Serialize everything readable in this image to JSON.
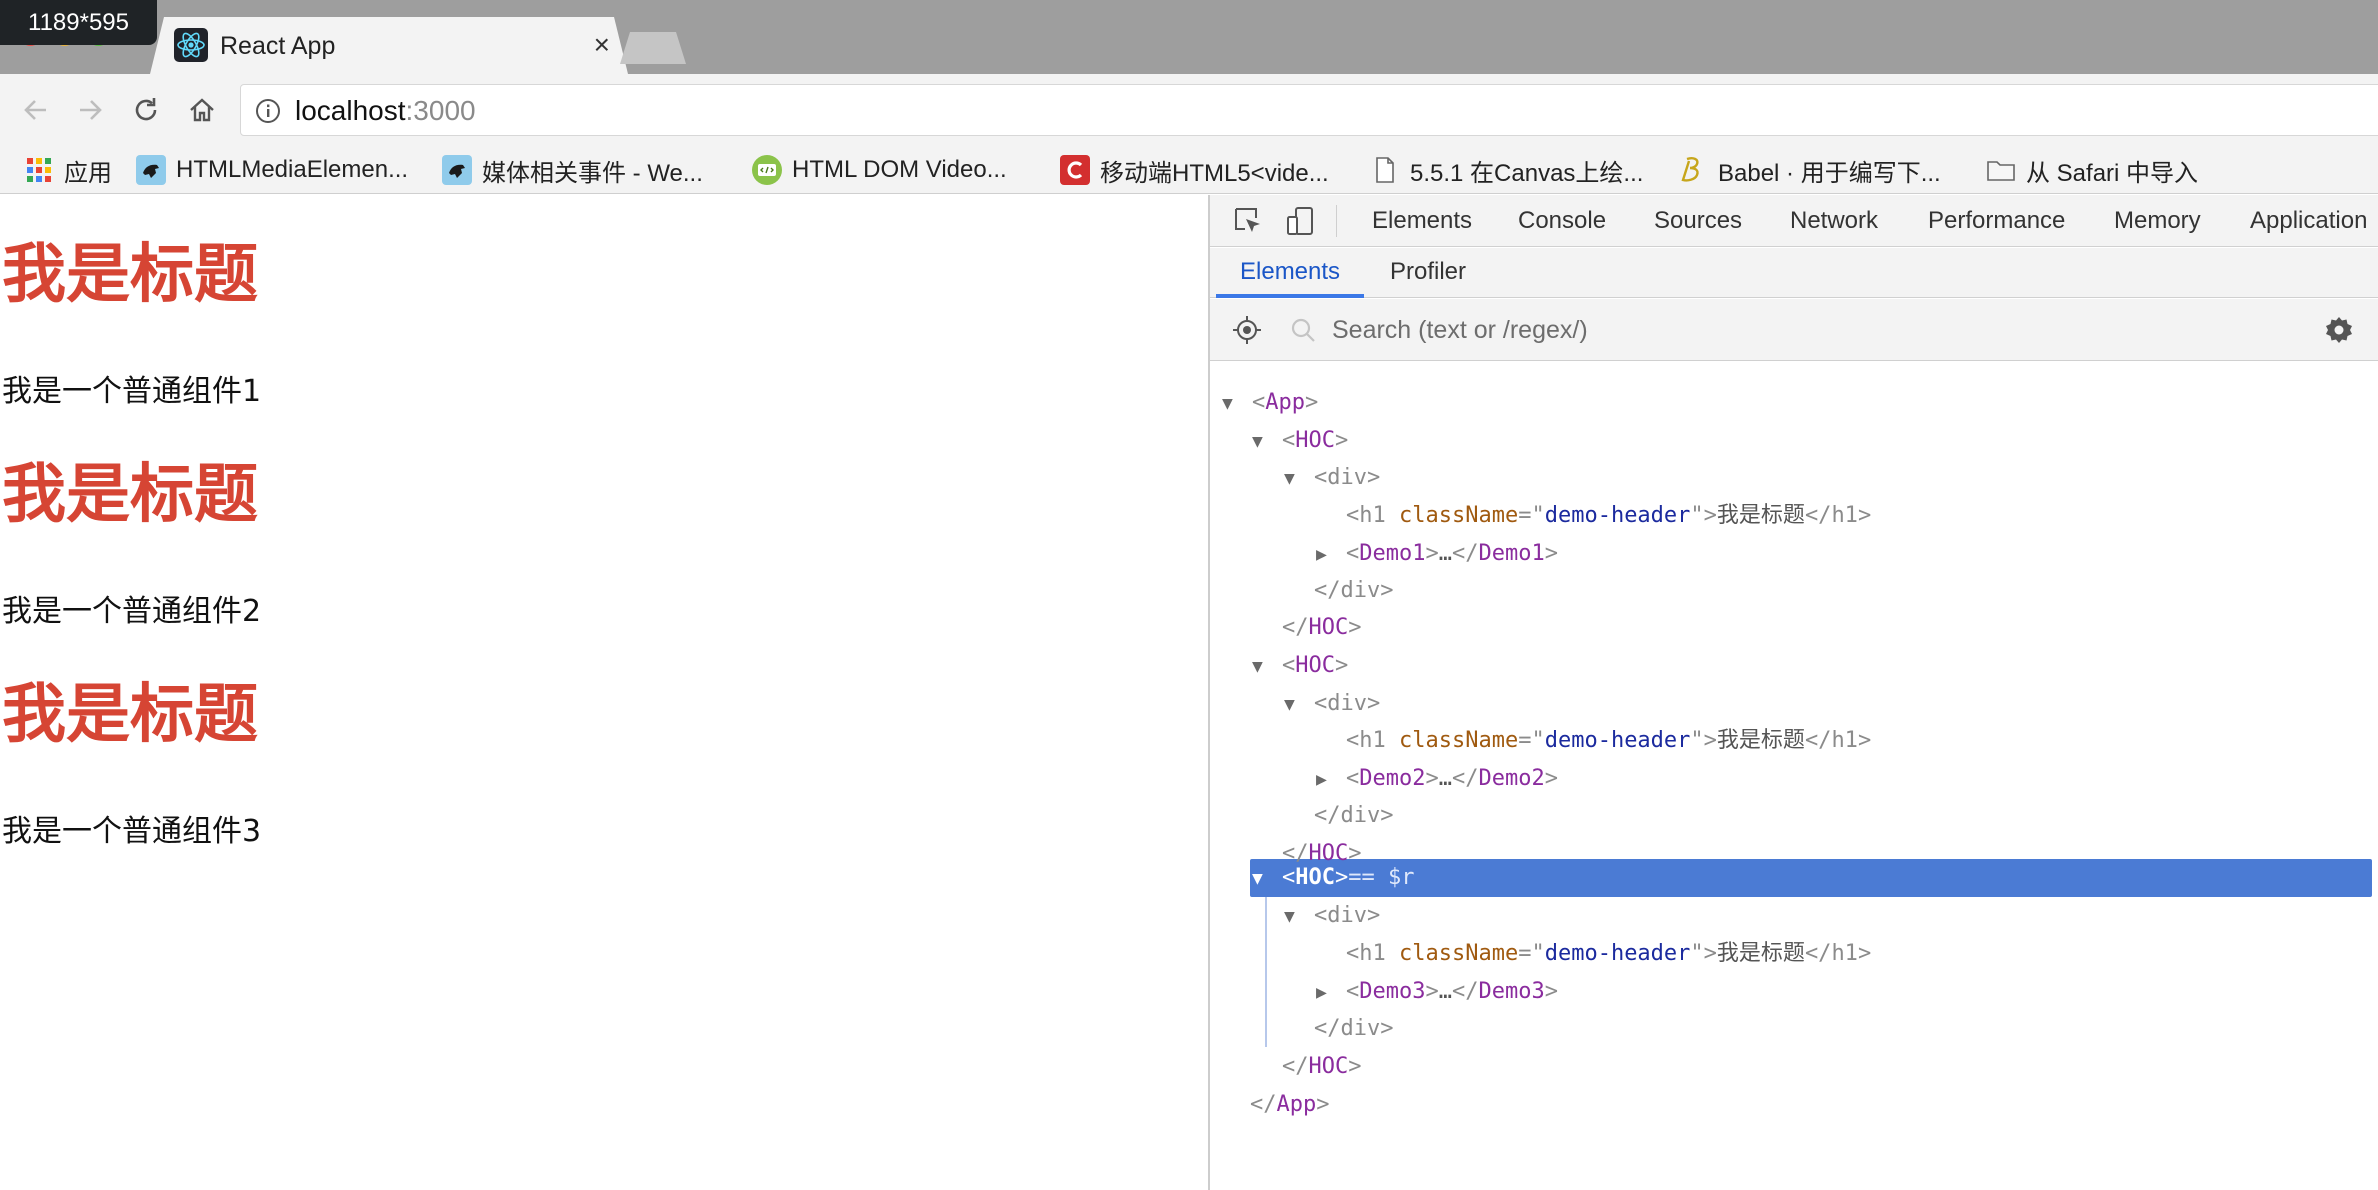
{
  "overlay": {
    "size_badge": "1189*595"
  },
  "tab": {
    "title": "React App",
    "close": "×"
  },
  "toolbar": {
    "url_host": "localhost",
    "url_port": ":3000"
  },
  "bookmarks": [
    {
      "label": "应用",
      "icon": "apps-grid-icon"
    },
    {
      "label": "HTMLMediaElemen...",
      "icon": "mdn-dino-icon"
    },
    {
      "label": "媒体相关事件 - We...",
      "icon": "mdn-dino-icon"
    },
    {
      "label": "HTML DOM Video...",
      "icon": "w3schools-icon"
    },
    {
      "label": "移动端HTML5<vide...",
      "icon": "csdn-c-icon"
    },
    {
      "label": "5.5.1 在Canvas上绘...",
      "icon": "document-icon"
    },
    {
      "label": "Babel · 用于编写下...",
      "icon": "babel-icon"
    },
    {
      "label": "从 Safari 中导入",
      "icon": "folder-icon"
    }
  ],
  "page": {
    "blocks": [
      {
        "heading": "我是标题",
        "text": "我是一个普通组件1"
      },
      {
        "heading": "我是标题",
        "text": "我是一个普通组件2"
      },
      {
        "heading": "我是标题",
        "text": "我是一个普通组件3"
      }
    ]
  },
  "devtools": {
    "tabs": [
      "Elements",
      "Console",
      "Sources",
      "Network",
      "Performance",
      "Memory",
      "Application"
    ],
    "subtabs": [
      "Elements",
      "Profiler"
    ],
    "search_placeholder": "Search (text or /regex/)",
    "tree": {
      "app_open": "App",
      "hoc": "HOC",
      "div": "div",
      "h1": "h1",
      "attr_name": "className",
      "attr_value": "demo-header",
      "h1_text": "我是标题",
      "ellipsis": "…",
      "demo1": "Demo1",
      "demo2": "Demo2",
      "demo3": "Demo3",
      "selected_ref": "== $r"
    }
  },
  "colors": {
    "heading_red": "#d64534",
    "selection_blue": "#4b7bd4",
    "tab_active_blue": "#3b78e7"
  }
}
